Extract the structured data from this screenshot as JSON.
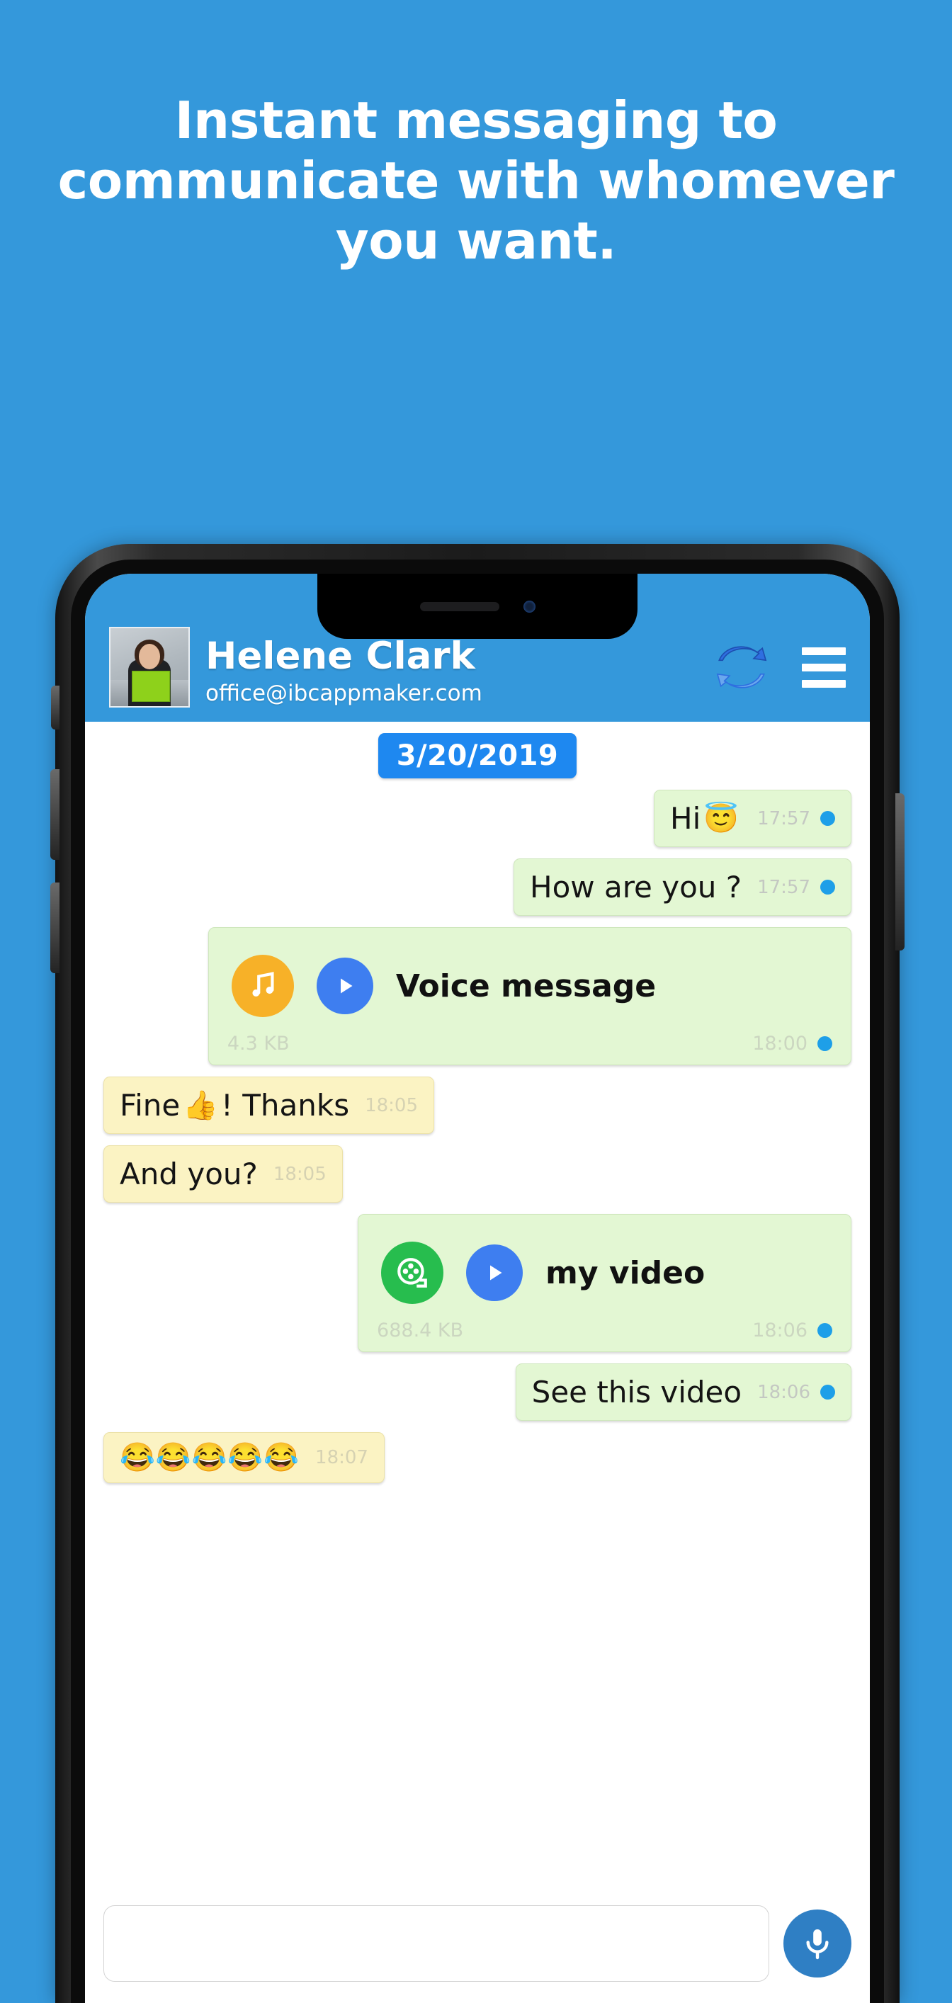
{
  "promo": {
    "headline": "Instant messaging to communicate with whomever you want."
  },
  "colors": {
    "background": "#3498db",
    "header": "#3498db",
    "date_chip": "#1e88f0",
    "outgoing_bubble": "#e3f7d3",
    "incoming_bubble": "#fbf3c3",
    "status_dot": "#1e9fe8",
    "audio_icon": "#f7b128",
    "video_icon": "#27bd4e",
    "play_icon": "#3e7ef0",
    "mic_button": "#2f7fc4"
  },
  "header": {
    "contact_name": "Helene Clark",
    "contact_email": "office@ibcappmaker.com",
    "sync_icon": "sync-refresh-icon",
    "menu_icon": "hamburger-menu-icon",
    "avatar_alt": "contact-avatar"
  },
  "chat": {
    "date_separator": "3/20/2019",
    "messages": [
      {
        "kind": "text",
        "direction": "out",
        "text": "Hi",
        "emoji": "😇",
        "time": "17:57",
        "status": "read"
      },
      {
        "kind": "text",
        "direction": "out",
        "text": "How are you ?",
        "emoji": "",
        "time": "17:57",
        "status": "read"
      },
      {
        "kind": "media",
        "direction": "out",
        "media_type": "audio",
        "label": "Voice message",
        "size": "4.3 KB",
        "time": "18:00",
        "status": "read"
      },
      {
        "kind": "text",
        "direction": "in",
        "text_before": "Fine",
        "emoji": "👍",
        "text_after": "! Thanks",
        "time": "18:05",
        "status": "none"
      },
      {
        "kind": "text",
        "direction": "in",
        "text": "And you?",
        "emoji": "",
        "time": "18:05",
        "status": "none"
      },
      {
        "kind": "media",
        "direction": "out",
        "media_type": "video",
        "label": "my video",
        "size": "688.4 KB",
        "time": "18:06",
        "status": "read"
      },
      {
        "kind": "text",
        "direction": "out",
        "text": "See this video",
        "emoji": "",
        "time": "18:06",
        "status": "read"
      },
      {
        "kind": "emoji",
        "direction": "in",
        "text": "😂😂😂😂😂",
        "time": "18:07",
        "status": "none"
      }
    ]
  },
  "composer": {
    "input_value": "",
    "input_placeholder": "",
    "mic_icon": "microphone-icon"
  },
  "device": {
    "notch_speaker": "earpiece-speaker",
    "notch_camera": "front-camera",
    "buttons": [
      "mute-switch",
      "volume-up",
      "volume-down",
      "power"
    ]
  }
}
